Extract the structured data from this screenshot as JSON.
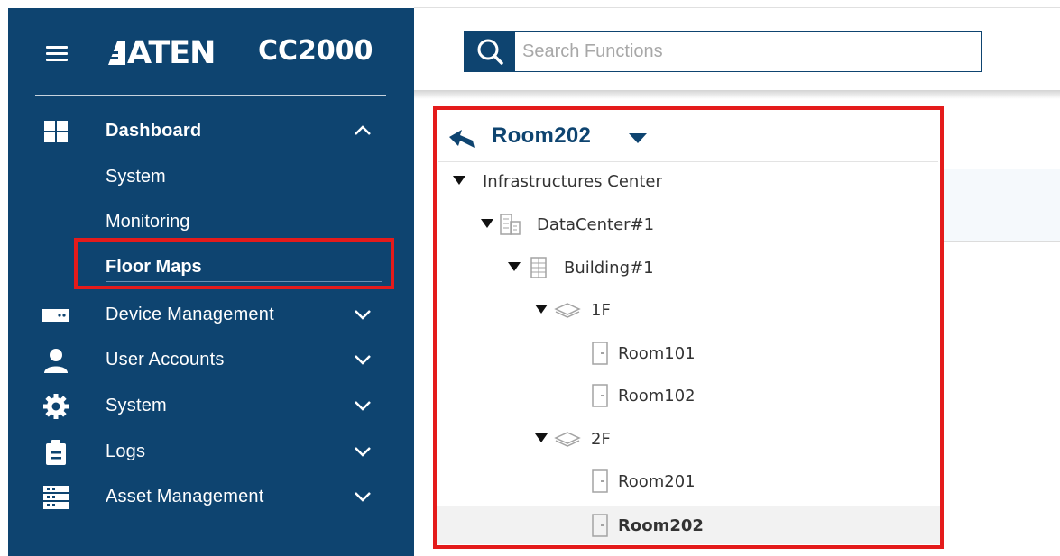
{
  "app": {
    "brand": "ATEN",
    "model": "CC2000"
  },
  "search": {
    "placeholder": "Search Functions"
  },
  "sidebar": {
    "dashboard": {
      "label": "Dashboard",
      "children": [
        "System",
        "Monitoring",
        "Floor Maps"
      ],
      "active_child": "Floor Maps"
    },
    "items": [
      {
        "label": "Device Management",
        "icon": "device-icon"
      },
      {
        "label": "User Accounts",
        "icon": "user-icon"
      },
      {
        "label": "System",
        "icon": "gear-icon"
      },
      {
        "label": "Logs",
        "icon": "clipboard-icon"
      },
      {
        "label": "Asset Management",
        "icon": "rack-icon"
      }
    ]
  },
  "tree": {
    "current": "Room202",
    "nodes": [
      {
        "label": "Infrastructures Center",
        "type": "center"
      },
      {
        "label": "DataCenter#1",
        "type": "datacenter-icon"
      },
      {
        "label": "Building#1",
        "type": "building-icon"
      },
      {
        "label": "1F",
        "type": "floor-icon"
      },
      {
        "label": "Room101",
        "type": "room-icon"
      },
      {
        "label": "Room102",
        "type": "room-icon"
      },
      {
        "label": "2F",
        "type": "floor-icon"
      },
      {
        "label": "Room201",
        "type": "room-icon"
      },
      {
        "label": "Room202",
        "type": "room-icon",
        "selected": true
      }
    ]
  },
  "colors": {
    "sidebar_bg": "#0e4470",
    "accent_text": "#0e4470",
    "highlight": "#e41b1b"
  }
}
